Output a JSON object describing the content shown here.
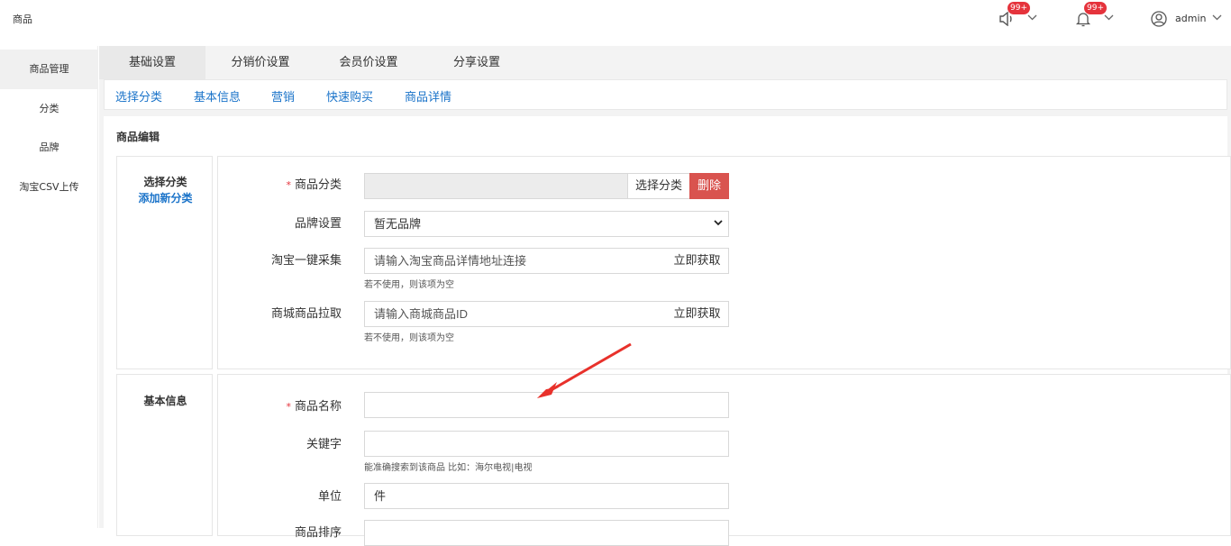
{
  "header": {
    "title": "商品",
    "notice_badge": "99+",
    "bell_badge": "99+",
    "user": "admin"
  },
  "sidebar": {
    "items": [
      {
        "label": "商品管理"
      },
      {
        "label": "分类"
      },
      {
        "label": "品牌"
      },
      {
        "label": "淘宝CSV上传"
      }
    ]
  },
  "tabs": [
    {
      "label": "基础设置"
    },
    {
      "label": "分销价设置"
    },
    {
      "label": "会员价设置"
    },
    {
      "label": "分享设置"
    }
  ],
  "subnav": [
    {
      "label": "选择分类"
    },
    {
      "label": "基本信息"
    },
    {
      "label": "营销"
    },
    {
      "label": "快速购买"
    },
    {
      "label": "商品详情"
    }
  ],
  "panel": {
    "title": "商品编辑"
  },
  "section_category": {
    "name": "选择分类",
    "add_link": "添加新分类",
    "category_label": "商品分类",
    "category_value": "",
    "select_button": "选择分类",
    "delete_button": "删除",
    "brand_label": "品牌设置",
    "brand_value": "暂无品牌",
    "taobao_label": "淘宝一键采集",
    "taobao_placeholder": "请输入淘宝商品详情地址连接",
    "taobao_button": "立即获取",
    "taobao_hint": "若不使用，则该项为空",
    "mall_label": "商城商品拉取",
    "mall_placeholder": "请输入商城商品ID",
    "mall_button": "立即获取",
    "mall_hint": "若不使用，则该项为空"
  },
  "section_basic": {
    "name": "基本信息",
    "name_label": "商品名称",
    "name_value": "",
    "keyword_label": "关键字",
    "keyword_value": "",
    "keyword_hint": "能准确搜索到该商品 比如：海尔电视|电视",
    "unit_label": "单位",
    "unit_value": "件",
    "sort_label": "商品排序"
  },
  "colors": {
    "accent": "#1a73c9",
    "danger": "#d9534f",
    "badge": "#e5333c"
  }
}
